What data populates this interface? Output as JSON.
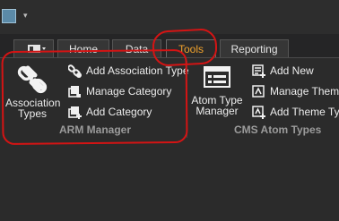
{
  "tabs": [
    "Home",
    "Data",
    "Tools",
    "Reporting"
  ],
  "arm_manager": {
    "group_label": "ARM Manager",
    "association_types": "Association\nTypes",
    "add_association_type": "Add Association Type",
    "manage_category": "Manage Category",
    "add_category": "Add Category"
  },
  "cms_atom_types": {
    "group_label": "CMS Atom Types",
    "atom_type_manager": "Atom Type\nManager",
    "add_new": "Add New",
    "manage_theme_types": "Manage Theme T",
    "add_theme_type": "Add Theme Type"
  },
  "colors": {
    "background": "#2b2b2b",
    "selected_tab_text": "#f0a22c",
    "annotation_red": "#d41414"
  }
}
